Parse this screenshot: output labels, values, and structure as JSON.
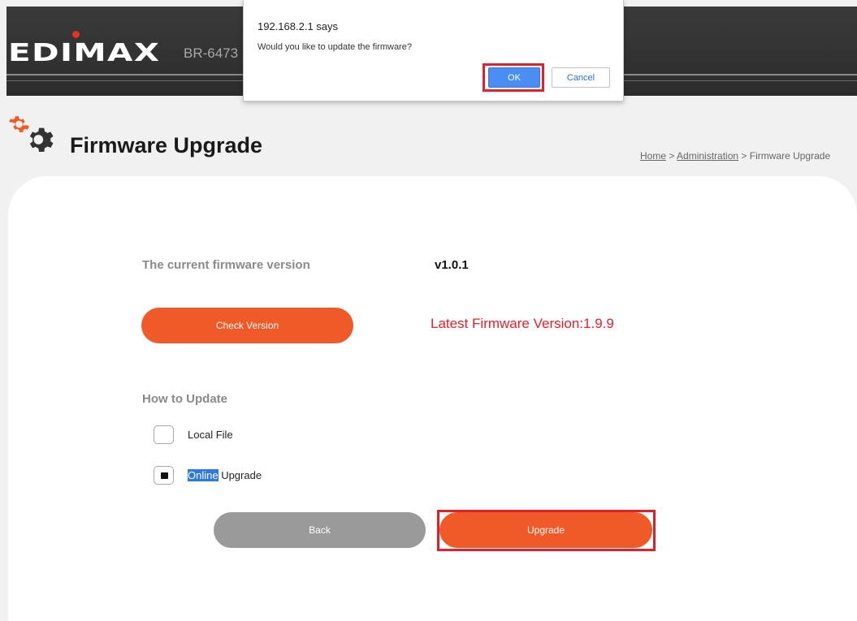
{
  "header": {
    "logo": "EDIMAX",
    "model": "BR-6473"
  },
  "page": {
    "title": "Firmware Upgrade",
    "breadcrumb": {
      "home": "Home",
      "sep1": " > ",
      "admin": "Administration",
      "sep2": " > ",
      "current": "Firmware Upgrade"
    }
  },
  "firmware": {
    "current_label": "The current firmware version",
    "current_value": "v1.0.1",
    "check_button": "Check Version",
    "latest_text": "Latest Firmware Version:1.9.9"
  },
  "update": {
    "heading": "How to Update",
    "options": [
      {
        "label": "Local File",
        "checked": false
      },
      {
        "label_selected": "Online",
        "label_rest": " Upgrade",
        "checked": true
      }
    ],
    "back_button": "Back",
    "upgrade_button": "Upgrade"
  },
  "dialog": {
    "title": "192.168.2.1 says",
    "message": "Would you like to update the firmware?",
    "ok": "OK",
    "cancel": "Cancel"
  },
  "colors": {
    "accent": "#f05a28",
    "highlight_frame": "#e0202a",
    "latest_text": "#e8202a"
  }
}
